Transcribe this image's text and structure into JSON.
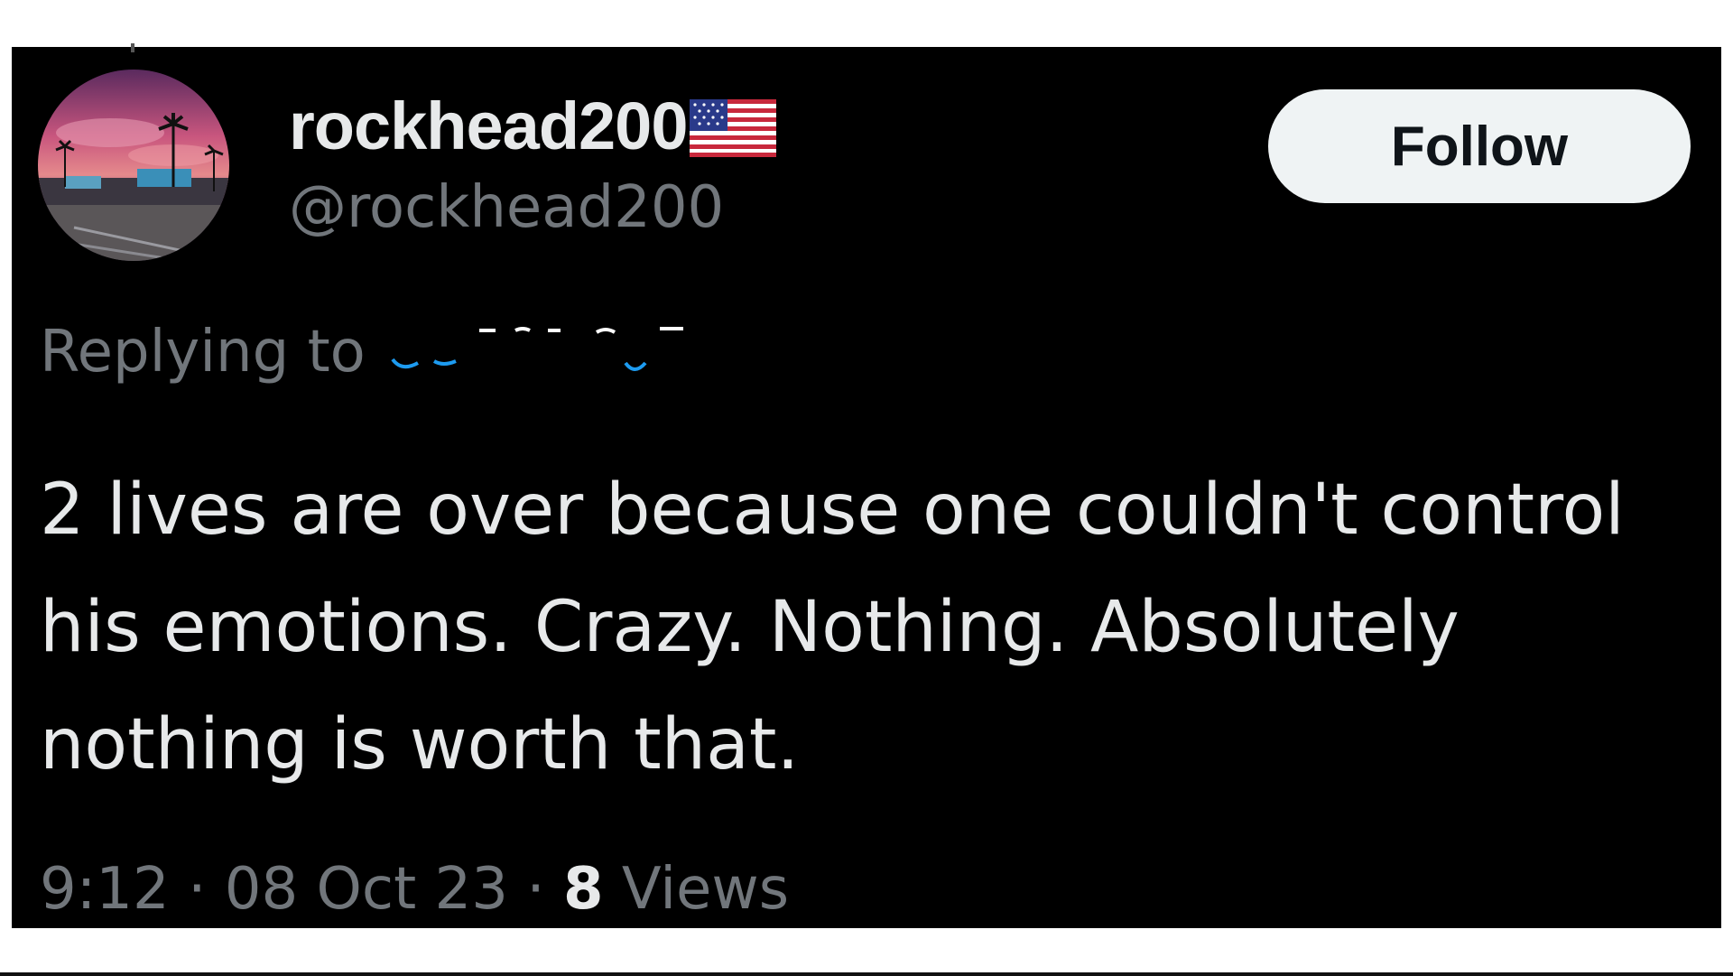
{
  "tweet": {
    "display_name": "rockhead200",
    "display_name_emoji": "us-flag-icon",
    "handle": "@rockhead200",
    "follow_label": "Follow",
    "replying_label": "Replying to",
    "reply_target_state": "redacted",
    "text": "2 lives are over because one couldn't control his emotions. Crazy. Nothing. Absolutely nothing is worth that.",
    "time": "9:12",
    "separator": "·",
    "date": "08 Oct 23",
    "views_count": "8",
    "views_label": "Views"
  },
  "colors": {
    "background": "#000000",
    "primary_text": "#e7e9ea",
    "secondary_text": "#71767b",
    "link_blue": "#1d9bf0",
    "button_bg": "#eff3f4",
    "button_text": "#0f1419"
  },
  "avatar": {
    "icon": "sunset-palm-avatar"
  }
}
